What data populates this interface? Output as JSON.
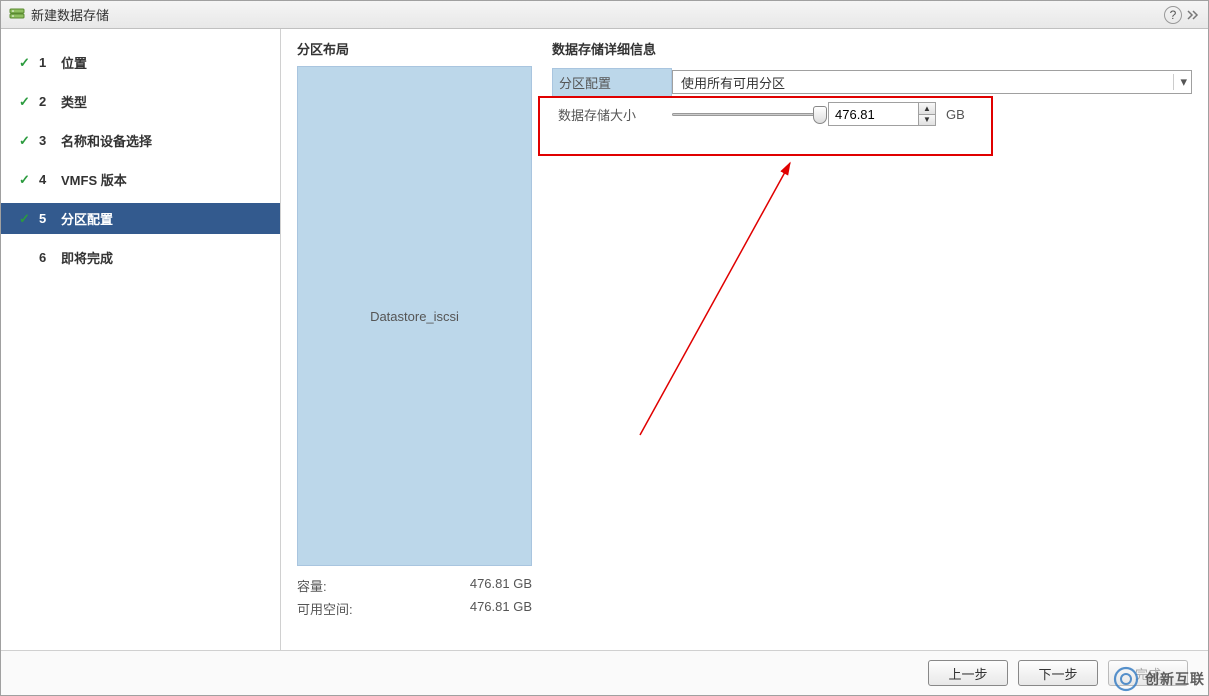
{
  "dialog": {
    "title": "新建数据存储"
  },
  "steps": [
    {
      "num": "1",
      "label": "位置",
      "done": true
    },
    {
      "num": "2",
      "label": "类型",
      "done": true
    },
    {
      "num": "3",
      "label": "名称和设备选择",
      "done": true
    },
    {
      "num": "4",
      "label": "VMFS 版本",
      "done": true
    },
    {
      "num": "5",
      "label": "分区配置",
      "done": true,
      "active": true
    },
    {
      "num": "6",
      "label": "即将完成",
      "done": false
    }
  ],
  "layout": {
    "title": "分区布局",
    "datastore_name": "Datastore_iscsi",
    "capacity_label": "容量:",
    "capacity_value": "476.81 GB",
    "free_label": "可用空间:",
    "free_value": "476.81 GB"
  },
  "details": {
    "title": "数据存储详细信息",
    "partition_config_label": "分区配置",
    "partition_config_value": "使用所有可用分区",
    "size_label": "数据存储大小",
    "size_value": "476.81",
    "size_unit": "GB"
  },
  "footer": {
    "back": "上一步",
    "next": "下一步",
    "finish": "完成"
  },
  "watermark": {
    "text": "创新互联"
  }
}
